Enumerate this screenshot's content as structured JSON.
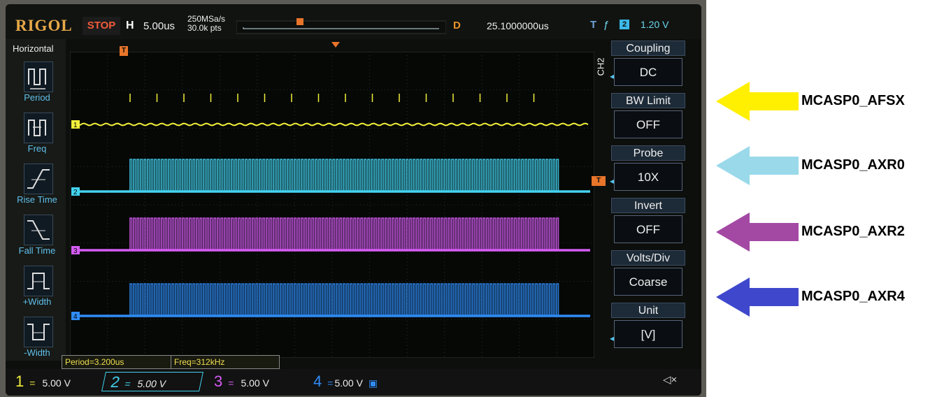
{
  "topbar": {
    "brand": "RIGOL",
    "run_state": "STOP",
    "h_letter": "H",
    "timebase": "5.00us",
    "sample_rate": "250MSa/s",
    "points": "30.0k pts",
    "d_letter": "D",
    "delay": "25.1000000us",
    "t_letter": "T",
    "trigger_edge_icon": "rising-edge-icon",
    "trigger_channel": "2",
    "trigger_level": "1.20 V"
  },
  "left_menu": {
    "title": "Horizontal",
    "items": [
      {
        "label": "Period",
        "icon": "period-icon"
      },
      {
        "label": "Freq",
        "icon": "frequency-icon"
      },
      {
        "label": "Rise Time",
        "icon": "rise-time-icon"
      },
      {
        "label": "Fall Time",
        "icon": "fall-time-icon"
      },
      {
        "label": "+Width",
        "icon": "positive-width-icon"
      },
      {
        "label": "-Width",
        "icon": "negative-width-icon"
      }
    ]
  },
  "right_menu": {
    "channel_label": "CH2",
    "items": [
      {
        "title": "Coupling",
        "value": "DC"
      },
      {
        "title": "BW Limit",
        "value": "OFF"
      },
      {
        "title": "Probe",
        "value": "10X"
      },
      {
        "title": "Invert",
        "value": "OFF"
      },
      {
        "title": "Volts/Div",
        "value": "Coarse"
      },
      {
        "title": "Unit",
        "value": "[V]"
      }
    ]
  },
  "measurements": {
    "period": "Period=3.200us",
    "freq": "Freq=312kHz"
  },
  "channel_bar": [
    {
      "num": "1",
      "scale": "5.00 V",
      "color": "#f2f03a"
    },
    {
      "num": "2",
      "scale": "5.00 V",
      "color": "#43d3f1"
    },
    {
      "num": "3",
      "scale": "5.00 V",
      "color": "#d55cf4"
    },
    {
      "num": "4",
      "scale": "5.00 V",
      "color": "#2f8cf6"
    }
  ],
  "traces": [
    {
      "marker": "1",
      "color": "#f2f03a"
    },
    {
      "marker": "2",
      "color": "#43d3f1"
    },
    {
      "marker": "3",
      "color": "#d55cf4"
    },
    {
      "marker": "4",
      "color": "#2f8cf6"
    }
  ],
  "trigger_marker": "T",
  "annotations": [
    {
      "label": "MCASP0_AFSX",
      "color": "#ffef00"
    },
    {
      "label": "MCASP0_AXR0",
      "color": "#99d9ea"
    },
    {
      "label": "MCASP0_AXR2",
      "color": "#a349a4"
    },
    {
      "label": "MCASP0_AXR4",
      "color": "#3f48cc"
    }
  ]
}
